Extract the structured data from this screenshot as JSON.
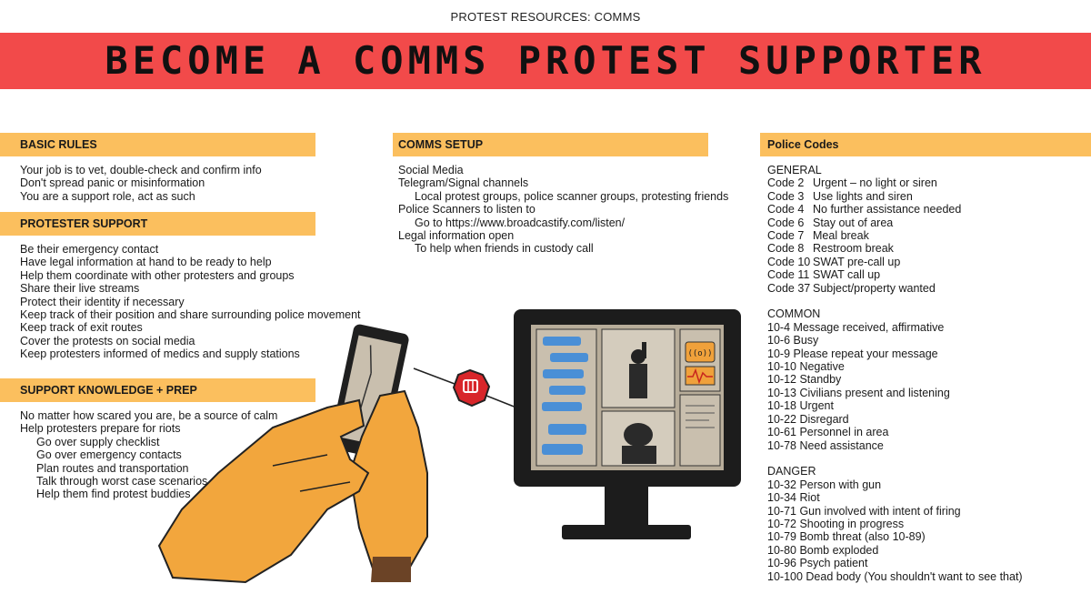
{
  "header": {
    "top_label": "PROTEST RESOURCES: COMMS",
    "title": "BECOME A COMMS PROTEST SUPPORTER"
  },
  "colors": {
    "banner": "#f24a4a",
    "section_bar": "#fbbf5e",
    "accent_dark": "#1a1a1a"
  },
  "basic_rules": {
    "heading": "BASIC RULES",
    "lines": [
      "Your job is to vet, double-check and confirm info",
      "Don't spread panic or misinformation",
      "You are a support role, act as such"
    ]
  },
  "protester_support": {
    "heading": "PROTESTER SUPPORT",
    "lines": [
      "Be their emergency contact",
      "Have legal information at hand to be ready to help",
      "Help them coordinate with other protesters and groups",
      "Share their live streams",
      "Protect their identity if necessary",
      "Keep track of their position and share surrounding police movement",
      "Keep track of exit routes",
      "Cover the protests on social media",
      "Keep protesters informed of medics and supply stations"
    ]
  },
  "support_knowledge": {
    "heading": "SUPPORT KNOWLEDGE + PREP",
    "lines": [
      "No matter how scared you are, be a source of calm",
      "Help protesters prepare for riots"
    ],
    "sub_lines": [
      "Go over supply checklist",
      "Go over emergency contacts",
      "Plan routes and transportation",
      "Talk through worst case scenarios",
      "Help them find protest buddies"
    ]
  },
  "comms_setup": {
    "heading": "COMMS SETUP",
    "items": [
      {
        "text": "Social Media",
        "indent": false
      },
      {
        "text": "Telegram/Signal channels",
        "indent": false
      },
      {
        "text": "Local protest groups, police scanner groups, protesting friends",
        "indent": true
      },
      {
        "text": "Police Scanners to listen to",
        "indent": false
      },
      {
        "text": "Go to https://www.broadcastify.com/listen/",
        "indent": true
      },
      {
        "text": "Legal information open",
        "indent": false
      },
      {
        "text": "To help when friends in custody call",
        "indent": true
      }
    ]
  },
  "police_codes": {
    "heading": "Police Codes",
    "general_label": "GENERAL",
    "general": [
      {
        "code": "Code 2",
        "meaning": "Urgent – no light or siren"
      },
      {
        "code": "Code 3",
        "meaning": "Use lights and siren"
      },
      {
        "code": "Code 4",
        "meaning": "No further assistance needed"
      },
      {
        "code": "Code 6",
        "meaning": "Stay out of area"
      },
      {
        "code": "Code 7",
        "meaning": "Meal break"
      },
      {
        "code": "Code 8",
        "meaning": "Restroom break"
      },
      {
        "code": "Code 10",
        "meaning": "SWAT pre-call up"
      },
      {
        "code": "Code 11",
        "meaning": "SWAT call up"
      },
      {
        "code": "Code 37",
        "meaning": "Subject/property wanted"
      }
    ],
    "common_label": "COMMON",
    "common": [
      "10-4 Message received, affirmative",
      "10-6 Busy",
      "10-9 Please repeat your message",
      "10-10 Negative",
      "10-12 Standby",
      "10-13 Civilians present and listening",
      "10-18 Urgent",
      "10-22 Disregard",
      "10-61 Personnel in area",
      "10-78 Need assistance"
    ],
    "danger_label": "DANGER",
    "danger": [
      "10-32 Person with gun",
      "10-34 Riot",
      "10-71 Gun involved with intent of firing",
      "10-72 Shooting in progress",
      "10-79 Bomb threat (also 10-89)",
      "10-80 Bomb exploded",
      "10-96 Psych patient",
      "10-100 Dead body (You shouldn't want to see that)"
    ]
  },
  "illustration": {
    "icons": [
      "hands-holding-phone-icon",
      "raised-fist-badge-icon",
      "monitor-icon",
      "radio-signal-icon"
    ],
    "signal_symbol": "((o))"
  }
}
